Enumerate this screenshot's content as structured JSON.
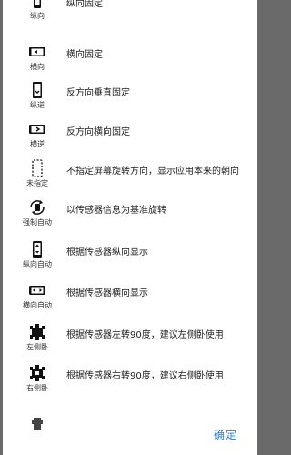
{
  "options": [
    {
      "icon": "portrait-lock-icon",
      "label": "纵向",
      "desc": "纵向固定"
    },
    {
      "icon": "landscape-lock-icon",
      "label": "横向",
      "desc": "横向固定"
    },
    {
      "icon": "reverse-portrait-icon",
      "label": "纵逆",
      "desc": "反方向垂直固定"
    },
    {
      "icon": "reverse-landscape-icon",
      "label": "横逆",
      "desc": "反方向横向固定"
    },
    {
      "icon": "unspecified-icon",
      "label": "未指定",
      "desc": "不指定屏幕旋转方向，显示应用本来的朝向"
    },
    {
      "icon": "force-auto-icon",
      "label": "强制自动",
      "desc": "以传感器信息为基准旋转"
    },
    {
      "icon": "portrait-auto-icon",
      "label": "纵向自动",
      "desc": "根据传感器纵向显示"
    },
    {
      "icon": "landscape-auto-icon",
      "label": "横向自动",
      "desc": "根据传感器横向显示"
    },
    {
      "icon": "lie-left-icon",
      "label": "左侧卧",
      "desc": "根据传感器左转90度，建议左侧卧使用"
    },
    {
      "icon": "lie-right-icon",
      "label": "右侧卧",
      "desc": "根据传感器右转90度，建议右侧卧使用"
    }
  ],
  "ok_label": "确定"
}
